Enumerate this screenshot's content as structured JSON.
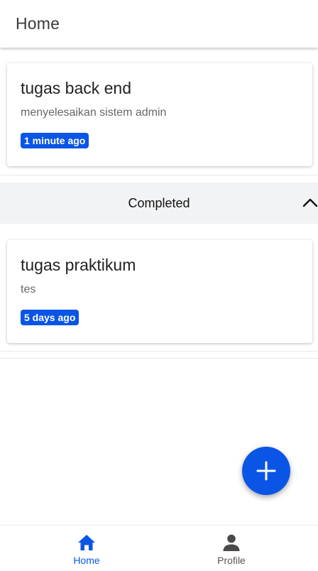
{
  "appbar": {
    "title": "Home"
  },
  "active_tasks": [
    {
      "title": "tugas back end",
      "description": "menyelesaikan sistem admin",
      "time": "1 minute ago"
    }
  ],
  "completed_section": {
    "label": "Completed",
    "expanded": true,
    "tasks": [
      {
        "title": "tugas praktikum",
        "description": "tes",
        "time": "5 days ago"
      }
    ]
  },
  "fab": {
    "icon": "plus-icon"
  },
  "bottom_nav": {
    "items": [
      {
        "label": "Home",
        "icon": "home-icon",
        "active": true
      },
      {
        "label": "Profile",
        "icon": "person-icon",
        "active": false
      }
    ]
  },
  "colors": {
    "accent": "#0a55e6",
    "section_bg": "#f2f3f5",
    "muted_text": "#666666"
  }
}
